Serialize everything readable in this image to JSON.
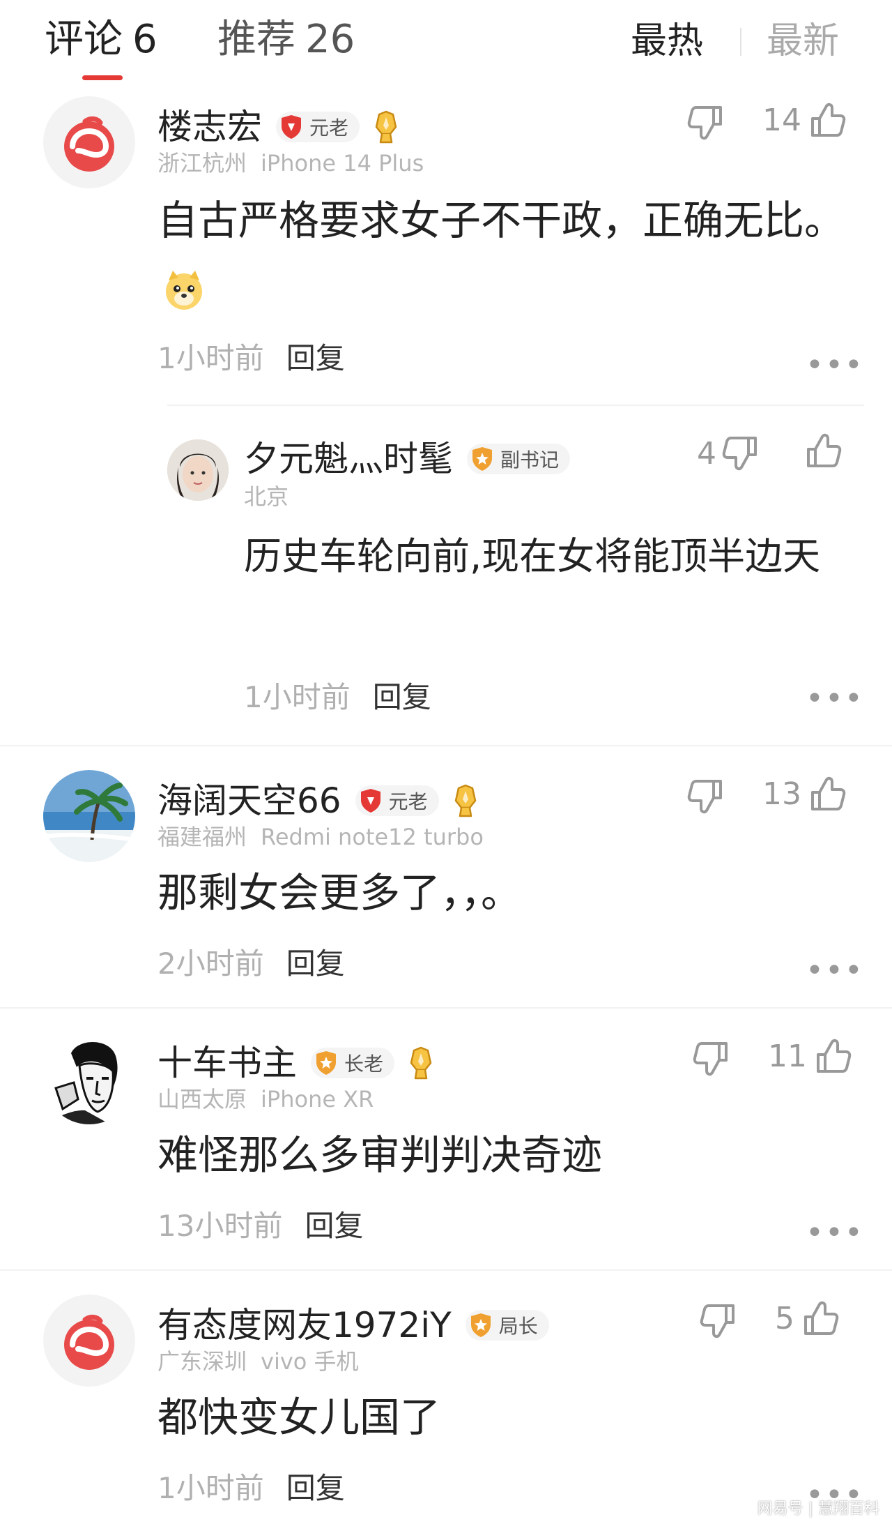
{
  "tabs": {
    "comments_label": "评论",
    "comments_count": "6",
    "recommend_label": "推荐",
    "recommend_count": "26",
    "sort_hot": "最热",
    "sort_new": "最新"
  },
  "comments": [
    {
      "username": "楼志宏",
      "badge": "元老",
      "location": "浙江杭州",
      "device": "iPhone 14 Plus",
      "text": "自古严格要求女子不干政，正确无比。",
      "time": "1小时前",
      "reply": "回复",
      "likes": "14",
      "replies": [
        {
          "username": "夕元魁灬时髦",
          "badge": "副书记",
          "location": "北京",
          "text": "历史车轮向前,现在女将能顶半边天",
          "time": "1小时前",
          "reply": "回复",
          "dislikes": "4"
        }
      ]
    },
    {
      "username": "海阔天空66",
      "badge": "元老",
      "location": "福建福州",
      "device": "Redmi note12 turbo",
      "text": "那剩女会更多了，，。",
      "time": "2小时前",
      "reply": "回复",
      "likes": "13"
    },
    {
      "username": "十车书主",
      "badge": "长老",
      "location": "山西太原",
      "device": "iPhone XR",
      "text": "难怪那么多审判判决奇迹",
      "time": "13小时前",
      "reply": "回复",
      "likes": "11"
    },
    {
      "username": "有态度网友1972iY",
      "badge": "局长",
      "location": "广东深圳",
      "device": "vivo 手机",
      "text": "都快变女儿国了",
      "time": "1小时前",
      "reply": "回复",
      "likes": "5"
    }
  ],
  "more_glyph": "•••",
  "watermark": "网易号 | 慧翔百科",
  "colors": {
    "accent": "#e53935",
    "badge_red": "#e53935",
    "badge_orange": "#f0a030",
    "text": "#222222",
    "muted": "#b5b5b5"
  },
  "icons": [
    "thumb-up-icon",
    "thumb-down-icon",
    "more-icon",
    "shield-badge-icon",
    "crown-icon",
    "netease-logo-avatar"
  ]
}
